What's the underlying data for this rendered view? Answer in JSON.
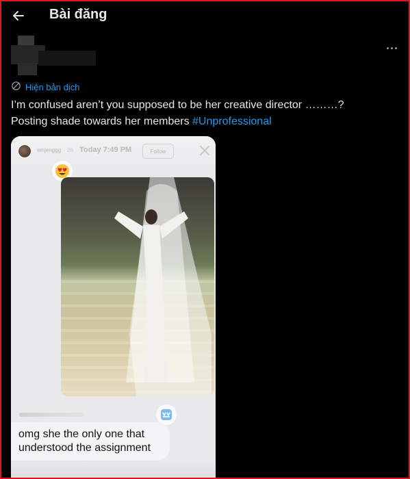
{
  "header": {
    "title": "Bài đăng"
  },
  "translate": {
    "label": "Hiện bản dịch"
  },
  "tweet": {
    "text": "I’m confused aren’t you supposed to be her creative director ………?",
    "text_line2": "Posting shade towards her members",
    "hashtag": "#Unprofessional"
  },
  "media": {
    "story": {
      "username": "emjenggg",
      "ago": "2h",
      "today": "Today 7:49 PM",
      "follow": "Follow"
    },
    "message": {
      "line1": "omg she the only one that",
      "line2": "understood the assignment"
    }
  },
  "icons": {
    "back": "back-arrow-icon",
    "more": "more-horizontal-icon",
    "translate": "translate-icon",
    "close": "close-icon",
    "heart_eyes": "heart-eyes-emoji-icon",
    "laugh": "laugh-reaction-icon"
  },
  "colors": {
    "background": "#000000",
    "text": "#e7e9ea",
    "link": "#1d9bf0",
    "frame": "#e0161b"
  }
}
